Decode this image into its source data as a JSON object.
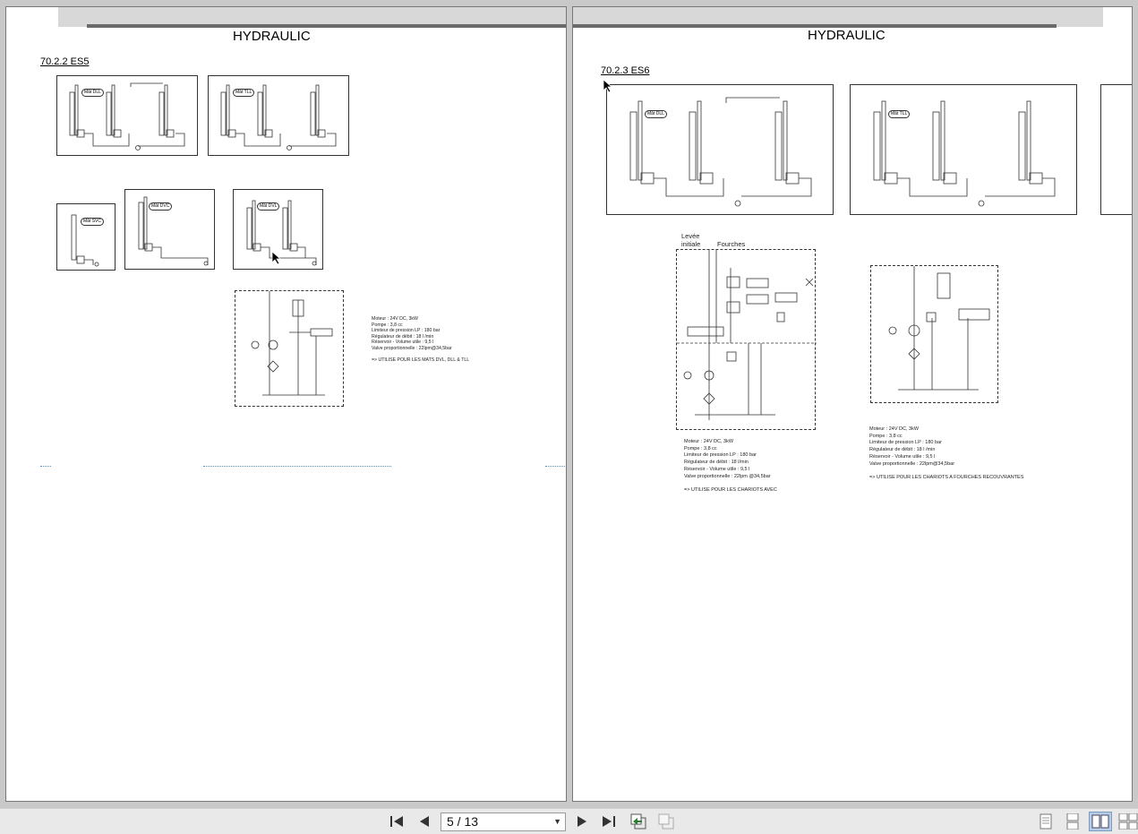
{
  "left_page": {
    "title": "HYDRAULIC",
    "section": "70.2.2  ES5",
    "labels": {
      "dll": "Mât DLL",
      "tll": "Mât TLL",
      "svc": "Mât SVC",
      "dvc": "Mât DVC",
      "dvl": "Mât DVL"
    },
    "specs": [
      "Moteur : 24V DC, 3kW",
      "Pompe : 3,8 cc",
      "Limiteur de pression LP : 180 bar",
      "Régulateur de débit : 18 l /min",
      "Réservoir - Volume utile : 9,5 l",
      "Valve proportionnelle : 22lpm@34,5bar",
      "",
      "=> UTILISE POUR LES MATS DVL, DLL & TLL"
    ]
  },
  "right_page": {
    "title": "HYDRAULIC",
    "section": "70.2.3  ES6",
    "labels": {
      "dll": "Mât DLL",
      "tll": "Mât TLL"
    },
    "schematic_label_1": "Levée",
    "schematic_label_2": "initiale",
    "schematic_label_3": "Fourches",
    "specs_left": [
      "Moteur : 24V DC, 3kW",
      "Pompe : 3,8 cc",
      "Limiteur de pression LP : 180 bar",
      "Régulateur de débit : 18 l/min",
      "Réservoir - Volume utile : 9,5 l",
      "Valve proportionnelle : 22lpm @34,5bar",
      "",
      "=> UTILISE POUR LES CHARIOTS AVEC"
    ],
    "specs_right": [
      "Moteur : 24V DC, 3kW",
      "Pompe : 3,8 cc",
      "Limiteur de pression LP : 180 bar",
      "Régulateur de débit : 18 l /min",
      "Réservoir - Volume utile : 9,5 l",
      "Valve proportionnelle : 22lpm@34,5bar",
      "",
      "=> UTILISE POUR LES CHARIOTS A FOURCHES RECOUVRANTES"
    ]
  },
  "toolbar": {
    "page_indicator": "5 / 13",
    "icons": [
      "first-page-icon",
      "previous-page-icon",
      "next-page-icon",
      "last-page-icon",
      "go-back-icon",
      "go-forward-icon",
      "single-page-view-icon",
      "continuous-view-icon",
      "facing-pages-view-icon",
      "continuous-facing-view-icon"
    ],
    "active_view": "facing-pages-view-icon",
    "accent_color": "#b7cbe2"
  }
}
